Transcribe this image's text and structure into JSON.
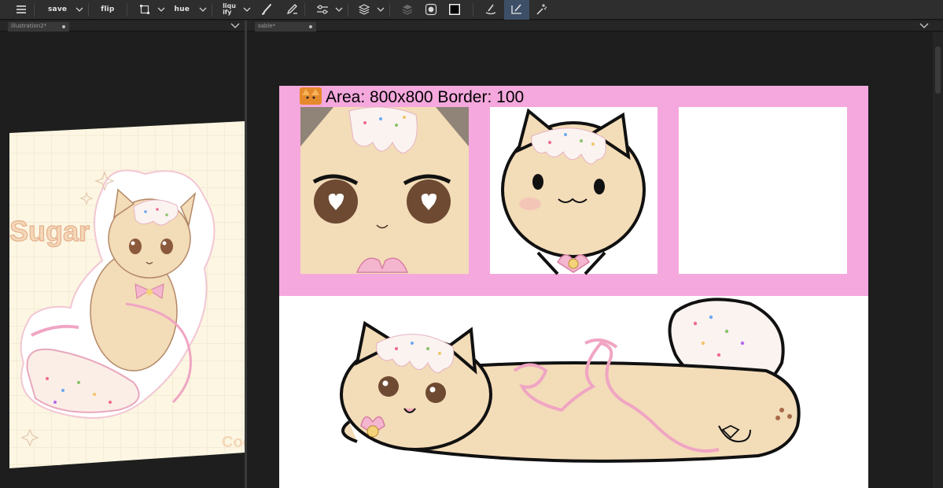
{
  "toolbar": {
    "save_label": "save",
    "flip_label": "flip",
    "hue_label": "hue",
    "liquify_top": "liqu",
    "liquify_bottom": "ify",
    "colors": {
      "foreground": "#000000",
      "active_tool": "#3d4f66"
    }
  },
  "left_document": {
    "tab_label": "illustration2*",
    "artwork": {
      "title_text": "Sugar",
      "corner_text": "Coo"
    }
  },
  "right_document": {
    "tab_label": "sable*",
    "template_header": "Area: 800x800 Border: 100",
    "colors": {
      "template_pink": "#f4a8dd",
      "cream": "#f3dcb8",
      "sprinkle_pink": "#f2b6cc"
    }
  },
  "icons": [
    "menu-icon",
    "chevron-down-icon",
    "transform-icon",
    "brush-icon",
    "pen-icon",
    "adjust-icon",
    "layers-icon",
    "layer-mask-icon",
    "circle-icon",
    "foreground-color-icon",
    "blend-icon",
    "select-brush-icon",
    "magic-wand-icon",
    "fox-badge-icon"
  ]
}
